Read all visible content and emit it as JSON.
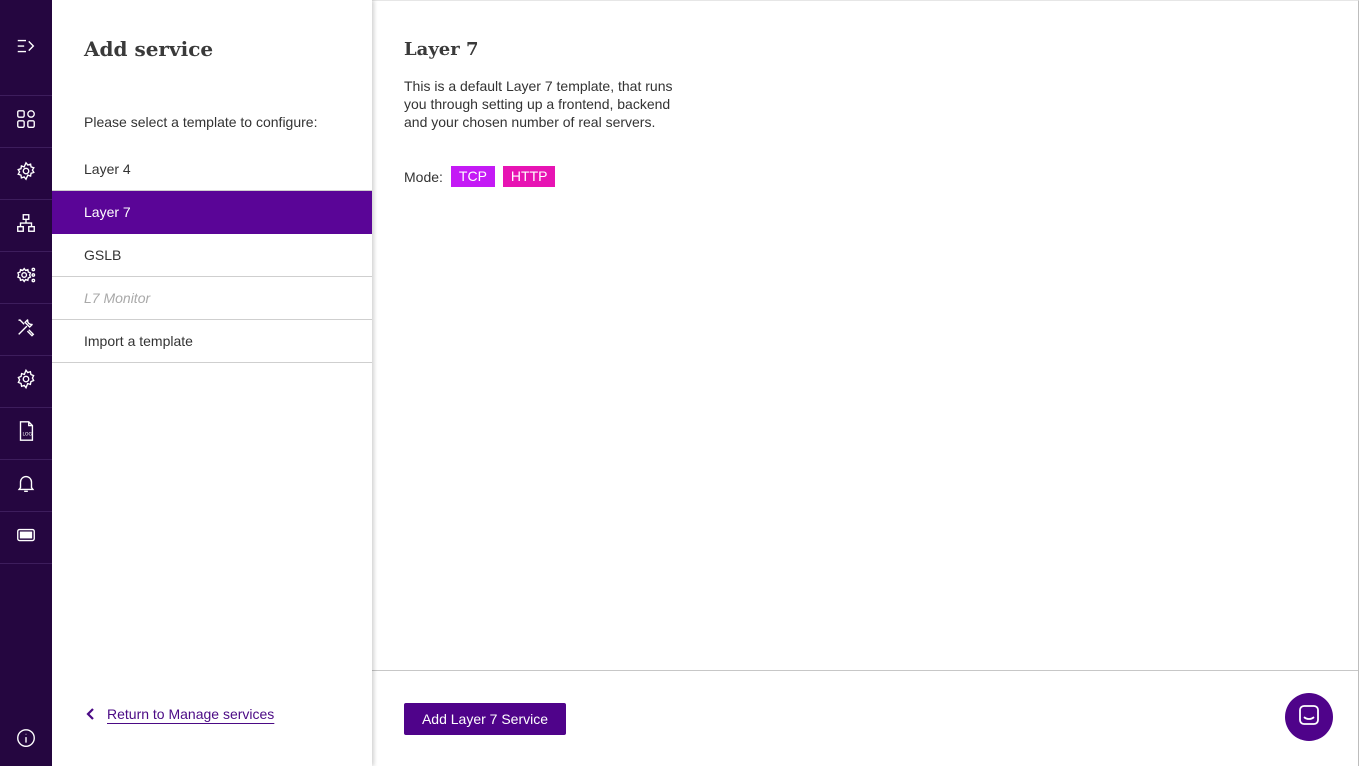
{
  "rail": {
    "icons": [
      "expand-menu-icon",
      "dashboard-icon",
      "services-icon",
      "network-icon",
      "cluster-settings-icon",
      "tools-icon",
      "settings-icon",
      "logs-icon",
      "notifications-icon",
      "ticket-icon",
      "info-icon"
    ],
    "background": "#250640"
  },
  "panel": {
    "title": "Add service",
    "instructions": "Please select a template to configure:",
    "templates": [
      {
        "label": "Layer 4",
        "state": "normal"
      },
      {
        "label": "Layer 7",
        "state": "active"
      },
      {
        "label": "GSLB",
        "state": "normal"
      },
      {
        "label": "L7 Monitor",
        "state": "disabled"
      },
      {
        "label": "Import a template",
        "state": "normal"
      }
    ],
    "return_link": "Return to Manage services"
  },
  "main": {
    "title": "Layer 7",
    "description": "This is a default Layer 7 template, that runs you through setting up a frontend, backend and your chosen number of real servers.",
    "mode_label": "Mode:",
    "modes": [
      {
        "label": "TCP",
        "color": "#c41af5"
      },
      {
        "label": "HTTP",
        "color": "#e714b3"
      }
    ],
    "add_button": "Add Layer 7 Service"
  },
  "colors": {
    "accent": "#5a0597",
    "button": "#4f038a"
  }
}
